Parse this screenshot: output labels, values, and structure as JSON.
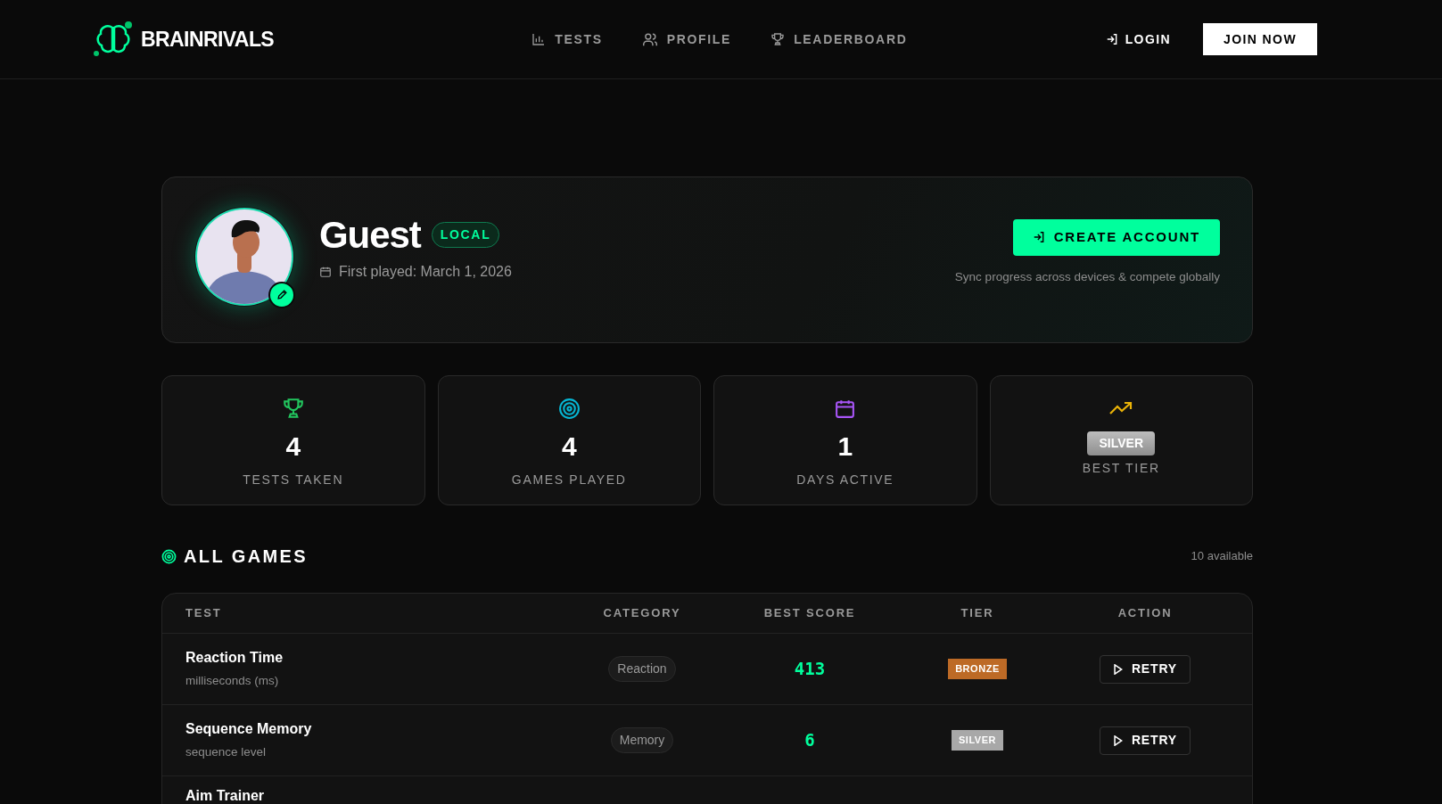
{
  "brand": {
    "name": "BRAINRIVALS"
  },
  "nav": [
    {
      "label": "TESTS",
      "selected": false
    },
    {
      "label": "PROFILE",
      "selected": false
    },
    {
      "label": "LEADERBOARD",
      "selected": false
    }
  ],
  "auth": {
    "login": "LOGIN",
    "join": "JOIN NOW"
  },
  "profile": {
    "name": "Guest",
    "badge": "LOCAL",
    "first_played": "First played: March 1, 2026",
    "cta": "CREATE ACCOUNT",
    "cta_note": "Sync progress across devices & compete globally"
  },
  "stats": [
    {
      "kind": "number",
      "color": "#22c55e",
      "value": "4",
      "label": "TESTS TAKEN"
    },
    {
      "kind": "number",
      "color": "#06b6d4",
      "value": "4",
      "label": "GAMES PLAYED"
    },
    {
      "kind": "number",
      "color": "#a855f7",
      "value": "1",
      "label": "DAYS ACTIVE"
    },
    {
      "kind": "tier",
      "color": "#eab308",
      "value": "SILVER",
      "label": "BEST TIER"
    }
  ],
  "section": {
    "title": "ALL GAMES",
    "count": "10 available"
  },
  "table": {
    "columns": [
      "TEST",
      "CATEGORY",
      "BEST SCORE",
      "TIER",
      "ACTION"
    ],
    "rows": [
      {
        "name": "Reaction Time",
        "unit": "milliseconds (ms)",
        "category": "Reaction",
        "score": "413",
        "color": "#bd6a26",
        "tier_label": "BRONZE",
        "action": "RETRY"
      },
      {
        "name": "Sequence Memory",
        "unit": "sequence level",
        "category": "Memory",
        "score": "6",
        "color": "#a8a8a8",
        "tier_label": "SILVER",
        "action": "RETRY"
      },
      {
        "name": "Aim Trainer"
      }
    ]
  }
}
